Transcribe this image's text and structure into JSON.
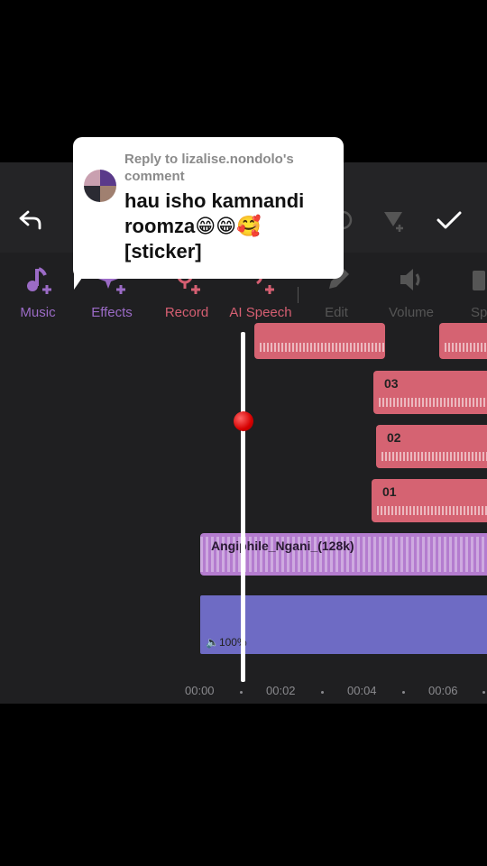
{
  "comment": {
    "header": "Reply to lizalise.nondolo's comment",
    "text": "hau isho kamnandi roomza😁😁🥰 [sticker]"
  },
  "toolbar": {
    "items": [
      {
        "label": "Music",
        "icon": "music-note-plus-icon",
        "color": "#9b6bc6"
      },
      {
        "label": "Effects",
        "icon": "sparkle-plus-icon",
        "color": "#9b6bc6"
      },
      {
        "label": "Record",
        "icon": "microphone-plus-icon",
        "color": "#d65f72"
      },
      {
        "label": "AI Speech",
        "icon": "ai-speech-icon",
        "color": "#d65f72"
      },
      {
        "label": "Edit",
        "icon": "pencil-icon",
        "color": "#555555"
      },
      {
        "label": "Volume",
        "icon": "speaker-icon",
        "color": "#555555"
      },
      {
        "label": "Sp",
        "icon": "speed-icon",
        "color": "#555555"
      }
    ]
  },
  "tracks": {
    "record_clips": [
      "03",
      "02",
      "01"
    ],
    "music_clip": "Angiphile_Ngani_(128k)",
    "video_volume": "100%"
  },
  "timeline": {
    "ticks": [
      "00:00",
      "00:02",
      "00:04",
      "00:06"
    ]
  },
  "colors": {
    "accent_purple": "#9b6bc6",
    "accent_red": "#d65f72",
    "video_clip": "#6e6bc4",
    "playhead_knob": "#e00000"
  }
}
